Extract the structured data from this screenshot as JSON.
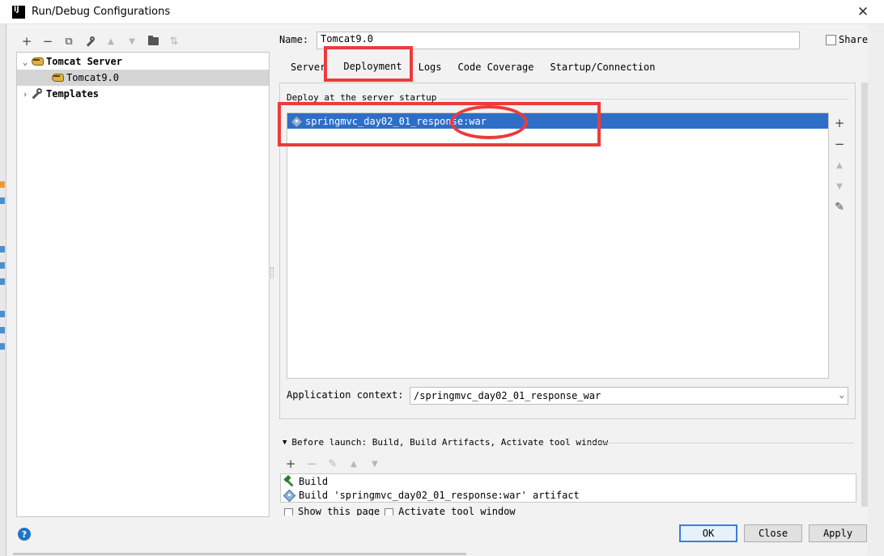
{
  "window": {
    "title": "Run/Debug Configurations",
    "icon_text": "IJ"
  },
  "left_toolbar": [
    {
      "name": "add-icon",
      "glyph": "+",
      "enabled": true
    },
    {
      "name": "remove-icon",
      "glyph": "−",
      "enabled": true
    },
    {
      "name": "copy-icon",
      "glyph": "⧉",
      "enabled": true
    },
    {
      "name": "wrench-icon",
      "glyph": "🔧",
      "enabled": true
    },
    {
      "name": "move-up-icon",
      "glyph": "▲",
      "enabled": false
    },
    {
      "name": "move-down-icon",
      "glyph": "▼",
      "enabled": false
    },
    {
      "name": "folder-add-icon",
      "glyph": "▆",
      "enabled": true
    },
    {
      "name": "sort-icon",
      "glyph": "⇅",
      "enabled": false
    }
  ],
  "tree": {
    "group": {
      "label": "Tomcat Server",
      "expanded": true
    },
    "child": {
      "label": "Tomcat9.0",
      "selected": true
    },
    "templates": {
      "label": "Templates",
      "expanded": false
    }
  },
  "name_field": {
    "label": "Name:",
    "value": "Tomcat9.0"
  },
  "share": {
    "label": "Share",
    "checked": false
  },
  "tabs": [
    {
      "label": "Server",
      "active": false
    },
    {
      "label": "Deployment",
      "active": true
    },
    {
      "label": "Logs",
      "active": false
    },
    {
      "label": "Code Coverage",
      "active": false
    },
    {
      "label": "Startup/Connection",
      "active": false
    }
  ],
  "deployment": {
    "section_title": "Deploy at the server startup",
    "items": [
      {
        "label": "springmvc_day02_01_response:war",
        "selected": true
      }
    ],
    "side_buttons": [
      {
        "name": "add-icon",
        "glyph": "+"
      },
      {
        "name": "remove-icon",
        "glyph": "−"
      },
      {
        "name": "move-up-icon",
        "glyph": "▲"
      },
      {
        "name": "move-down-icon",
        "glyph": "▼"
      },
      {
        "name": "edit-icon",
        "glyph": "✎"
      }
    ],
    "context_label": "Application context:",
    "context_value": "/springmvc_day02_01_response_war"
  },
  "before_launch": {
    "title": "Before launch: Build, Build Artifacts, Activate tool window",
    "toolbar": [
      {
        "name": "add-icon",
        "glyph": "+"
      },
      {
        "name": "remove-icon",
        "glyph": "−"
      },
      {
        "name": "edit-icon",
        "glyph": "✎"
      },
      {
        "name": "move-up-icon",
        "glyph": "▲"
      },
      {
        "name": "move-down-icon",
        "glyph": "▼"
      }
    ],
    "items": [
      {
        "label": "Build",
        "icon": "hammer-icon"
      },
      {
        "label": "Build 'springmvc_day02_01_response:war' artifact",
        "icon": "artifact-icon"
      }
    ],
    "cut_options": [
      "Show this page",
      "Activate tool window"
    ]
  },
  "buttons": {
    "ok": "OK",
    "close": "Close",
    "apply": "Apply",
    "help": "?"
  },
  "colors": {
    "selection": "#2f6ec7",
    "annotation": "#ee3a3a",
    "default_button": "#3c7fd3"
  }
}
